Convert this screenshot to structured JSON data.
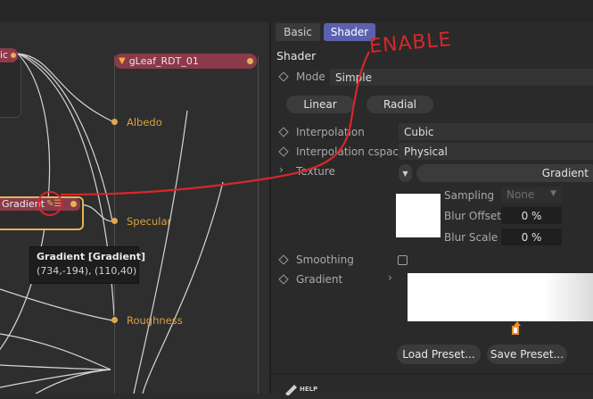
{
  "graph": {
    "top_node_fragment_label": "ic",
    "leaf_node": {
      "title": "gLeaf_RDT_01"
    },
    "ports": [
      {
        "id": "albedo",
        "label": "Albedo"
      },
      {
        "id": "specular",
        "label": "Specular"
      },
      {
        "id": "roughness",
        "label": "Roughness"
      }
    ],
    "gradient_node": {
      "label": "Gradient"
    },
    "tooltip": {
      "title": "Gradient [Gradient]",
      "subtitle": "(734,-194), (110,40)"
    }
  },
  "panel": {
    "tabs": [
      {
        "label": "Basic",
        "active": false
      },
      {
        "label": "Shader",
        "active": true
      }
    ],
    "section_title": "Shader",
    "mode": {
      "label": "Mode",
      "value": "Simple"
    },
    "gradient_types": [
      "Linear",
      "Radial"
    ],
    "interpolation": {
      "label": "Interpolation",
      "value": "Cubic"
    },
    "interpolation_cspace": {
      "label": "Interpolation cspace",
      "value": "Physical"
    },
    "texture": {
      "label": "Texture",
      "value": "Gradient"
    },
    "sampling": {
      "label": "Sampling",
      "value": "None"
    },
    "blur_offset": {
      "label": "Blur Offset",
      "value": "0 %"
    },
    "blur_scale": {
      "label": "Blur Scale",
      "value": "0 %"
    },
    "smoothing": {
      "label": "Smoothing",
      "checked": false
    },
    "gradient": {
      "label": "Gradient"
    },
    "buttons": {
      "load_preset": "Load Preset...",
      "save_preset": "Save Preset..."
    },
    "help_label": "HELP"
  },
  "annotation": {
    "text": "ENABLE"
  },
  "colors": {
    "accent_tab": "#5b61b0",
    "node_header": "#8a3a48",
    "port_orange": "#e0a84a",
    "annotation_red": "#d9262a"
  }
}
